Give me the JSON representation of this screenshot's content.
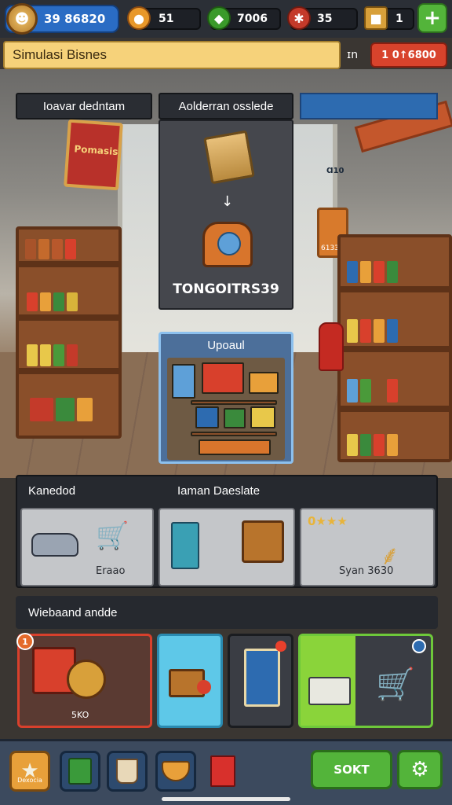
{
  "hud": {
    "level_text": "39 86820",
    "resources": [
      {
        "icon": "gold-coin-icon",
        "value": "51"
      },
      {
        "icon": "green-gem-icon",
        "value": "7006"
      },
      {
        "icon": "ladybug-icon",
        "value": "35"
      },
      {
        "icon": "crate-icon",
        "value": "1"
      }
    ],
    "add_label": "+"
  },
  "title_bar": {
    "title": "Simulasi Bisnes",
    "aux": "ɪn",
    "action_label": "1 0↑6800"
  },
  "labels": {
    "left": "Ioavar dedntam",
    "center": "Aolderran osslede",
    "right": ""
  },
  "scene": {
    "left_sign": "Pomasis",
    "price_tag": "6133",
    "right_tag": "Ɑ10"
  },
  "recipe": {
    "name": "TONGOITRS39"
  },
  "upgrade": {
    "title": "Upoaul"
  },
  "category": {
    "heading_left": "Kanedod",
    "heading_right": "Iaman Daeslate",
    "cards": [
      {
        "caption": "Eraao"
      },
      {
        "caption": ""
      },
      {
        "caption": "Syan 3630",
        "stars": "0★★★"
      }
    ]
  },
  "shop": {
    "heading": "Wiebaand andde",
    "cards": [
      {
        "caption": "5KO",
        "badge": "1"
      },
      {
        "caption": ""
      },
      {
        "caption": ""
      },
      {
        "caption": ""
      }
    ]
  },
  "bottom_bar": {
    "first_tool_label": "Dexocia",
    "sort_label": "SOKT"
  },
  "colors": {
    "accent_green": "#53b43a",
    "accent_red": "#d8432c",
    "panel_dark": "#26292f",
    "title_yellow": "#f6d27a"
  }
}
